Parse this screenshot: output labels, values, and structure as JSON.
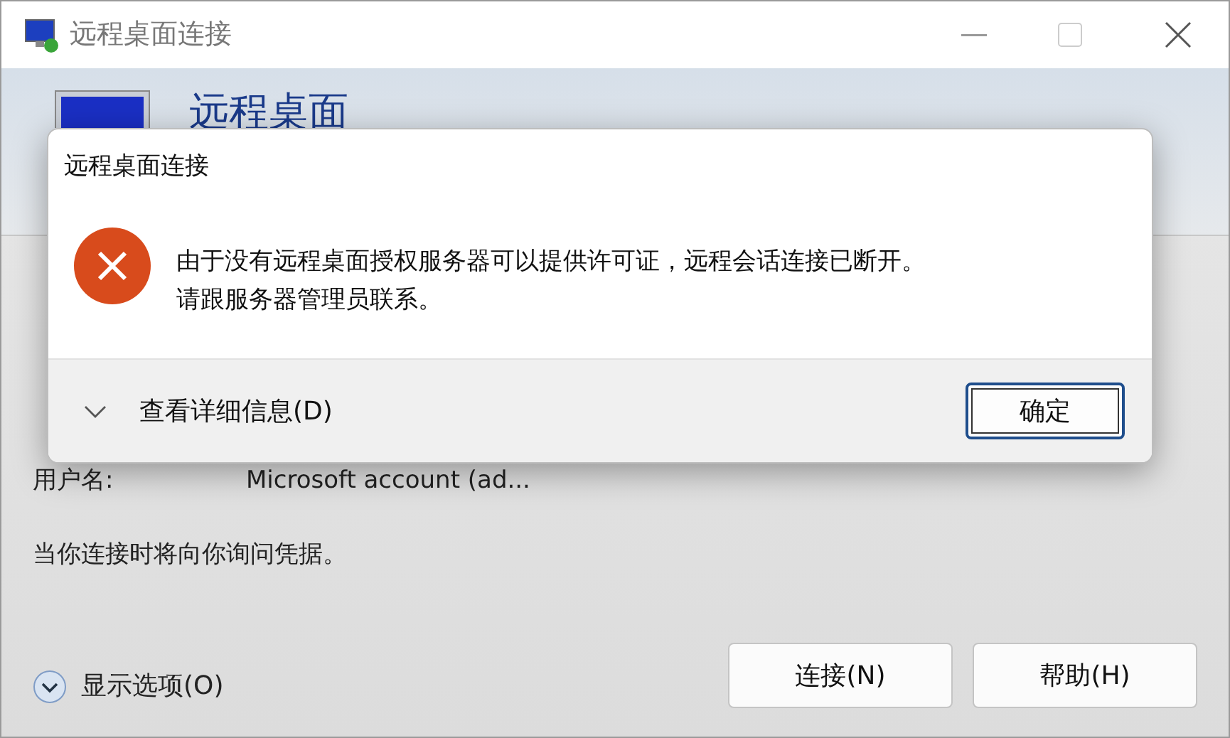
{
  "window": {
    "title": "远程桌面连接",
    "header": "远程桌面",
    "username_label": "用户名:",
    "username_value": "Microsoft account (ad...",
    "note": "当你连接时将向你询问凭据。",
    "options_toggle": {
      "label": "显示选项(O)",
      "expanded": false
    },
    "buttons": [
      "连接(N)",
      "帮助(H)"
    ]
  },
  "dialog": {
    "title": "远程桌面连接",
    "message": [
      "由于没有远程桌面授权服务器可以提供许可证，远程会话连接已断开。",
      "请跟服务器管理员联系。"
    ],
    "details_toggle": {
      "label": "查看详细信息(D)",
      "expanded": false
    },
    "button": "确定"
  }
}
